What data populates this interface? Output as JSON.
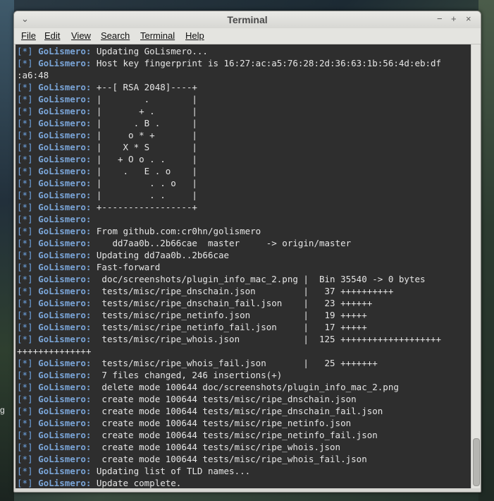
{
  "window": {
    "title": "Terminal",
    "controls": {
      "left": "⌄",
      "min": "−",
      "max": "+",
      "close": "×"
    }
  },
  "menu": [
    "File",
    "Edit",
    "View",
    "Search",
    "Terminal",
    "Help"
  ],
  "desktop": {
    "fragment": "g"
  },
  "terminal": {
    "prefix_bracket": "[*]",
    "prefix_name": "GoLismero:",
    "lines": [
      {
        "p": true,
        "t": "Updating GoLismero..."
      },
      {
        "p": true,
        "t": "Host key fingerprint is 16:27:ac:a5:76:28:2d:36:63:1b:56:4d:eb:df"
      },
      {
        "p": false,
        "t": ":a6:48"
      },
      {
        "p": true,
        "t": "+--[ RSA 2048]----+"
      },
      {
        "p": true,
        "t": "|        .        |"
      },
      {
        "p": true,
        "t": "|       + .       |"
      },
      {
        "p": true,
        "t": "|      . B .      |"
      },
      {
        "p": true,
        "t": "|     o * +       |"
      },
      {
        "p": true,
        "t": "|    X * S        |"
      },
      {
        "p": true,
        "t": "|   + O o . .     |"
      },
      {
        "p": true,
        "t": "|    .   E . o    |"
      },
      {
        "p": true,
        "t": "|         . . o   |"
      },
      {
        "p": true,
        "t": "|         . .     |"
      },
      {
        "p": true,
        "t": "+-----------------+"
      },
      {
        "p": true,
        "t": ""
      },
      {
        "p": true,
        "t": "From github.com:cr0hn/golismero"
      },
      {
        "p": true,
        "t": "   dd7aa0b..2b66cae  master     -> origin/master"
      },
      {
        "p": true,
        "t": "Updating dd7aa0b..2b66cae"
      },
      {
        "p": true,
        "t": "Fast-forward"
      },
      {
        "p": true,
        "t": " doc/screenshots/plugin_info_mac_2.png |  Bin 35540 -> 0 bytes"
      },
      {
        "p": true,
        "t": " tests/misc/ripe_dnschain.json         |   37 ++++++++++"
      },
      {
        "p": true,
        "t": " tests/misc/ripe_dnschain_fail.json    |   23 ++++++"
      },
      {
        "p": true,
        "t": " tests/misc/ripe_netinfo.json          |   19 +++++"
      },
      {
        "p": true,
        "t": " tests/misc/ripe_netinfo_fail.json     |   17 +++++"
      },
      {
        "p": true,
        "t": " tests/misc/ripe_whois.json            |  125 +++++++++++++++++++"
      },
      {
        "p": false,
        "t": "++++++++++++++"
      },
      {
        "p": true,
        "t": " tests/misc/ripe_whois_fail.json       |   25 +++++++"
      },
      {
        "p": true,
        "t": " 7 files changed, 246 insertions(+)"
      },
      {
        "p": true,
        "t": " delete mode 100644 doc/screenshots/plugin_info_mac_2.png"
      },
      {
        "p": true,
        "t": " create mode 100644 tests/misc/ripe_dnschain.json"
      },
      {
        "p": true,
        "t": " create mode 100644 tests/misc/ripe_dnschain_fail.json"
      },
      {
        "p": true,
        "t": " create mode 100644 tests/misc/ripe_netinfo.json"
      },
      {
        "p": true,
        "t": " create mode 100644 tests/misc/ripe_netinfo_fail.json"
      },
      {
        "p": true,
        "t": " create mode 100644 tests/misc/ripe_whois.json"
      },
      {
        "p": true,
        "t": " create mode 100644 tests/misc/ripe_whois_fail.json"
      },
      {
        "p": true,
        "t": "Updating list of TLD names..."
      },
      {
        "p": true,
        "t": "Update complete."
      }
    ]
  }
}
